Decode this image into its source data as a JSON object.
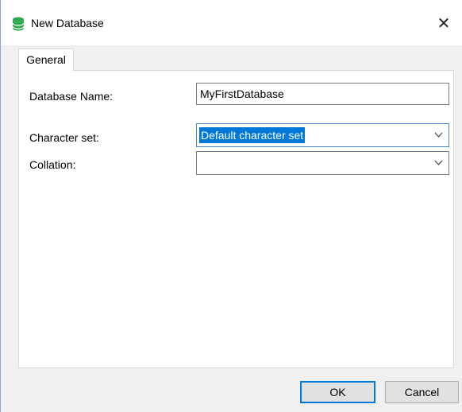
{
  "window": {
    "title": "New Database",
    "icon": "database-icon",
    "close_label": "✕"
  },
  "tabs": [
    {
      "label": "General",
      "active": true
    }
  ],
  "form": {
    "database_name": {
      "label": "Database Name:",
      "value": "MyFirstDatabase"
    },
    "character_set": {
      "label": "Character set:",
      "value": "Default character set",
      "selected": true
    },
    "collation": {
      "label": "Collation:",
      "value": ""
    }
  },
  "buttons": {
    "ok_label": "OK",
    "cancel_label": "Cancel"
  },
  "colors": {
    "icon_green": "#2fa84f",
    "selection_blue": "#0078d7",
    "default_button_border": "#0078d7"
  }
}
